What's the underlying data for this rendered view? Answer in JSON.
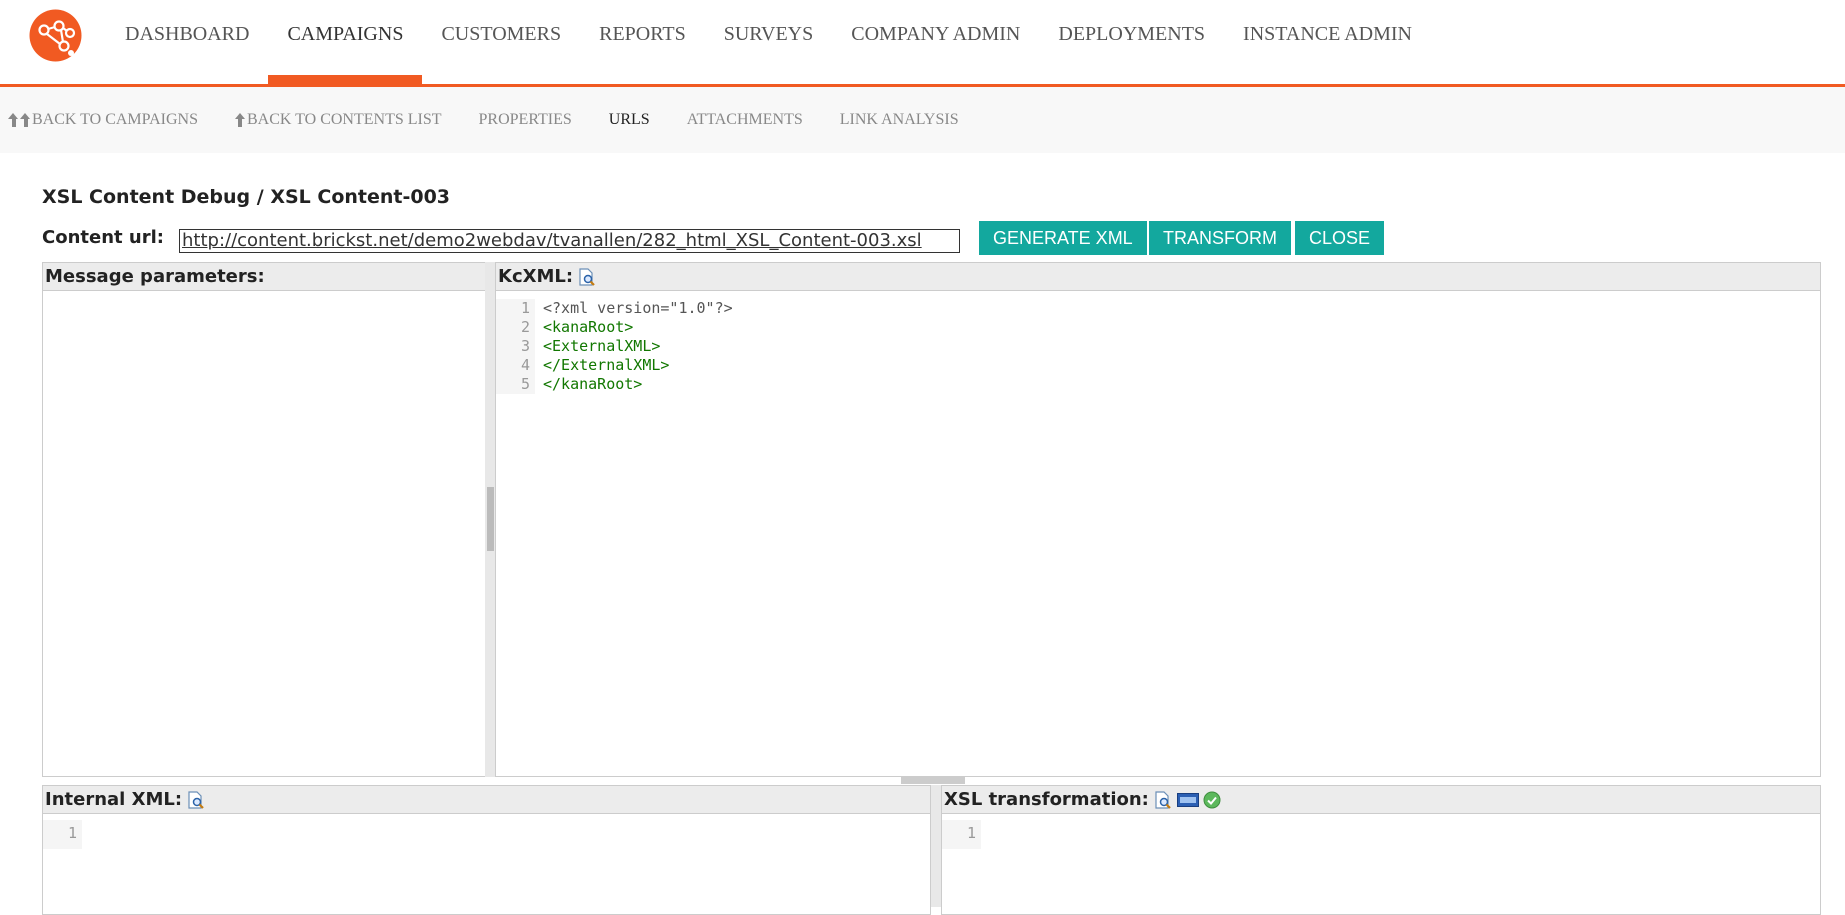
{
  "nav": {
    "items": [
      {
        "label": "DASHBOARD",
        "active": false
      },
      {
        "label": "CAMPAIGNS",
        "active": true
      },
      {
        "label": "CUSTOMERS",
        "active": false
      },
      {
        "label": "REPORTS",
        "active": false
      },
      {
        "label": "SURVEYS",
        "active": false
      },
      {
        "label": "COMPANY ADMIN",
        "active": false
      },
      {
        "label": "DEPLOYMENTS",
        "active": false
      },
      {
        "label": "INSTANCE ADMIN",
        "active": false
      }
    ]
  },
  "subnav": {
    "back_campaigns": "BACK TO CAMPAIGNS",
    "back_contents": "BACK TO CONTENTS LIST",
    "properties": "PROPERTIES",
    "urls": "URLS",
    "attachments": "ATTACHMENTS",
    "link_analysis": "LINK ANALYSIS"
  },
  "page": {
    "title": "XSL Content Debug / XSL Content-003",
    "url_label": "Content url:",
    "url_value": "http://content.brickst.net/demo2webdav/tvanallen/282_html_XSL_Content-003.xsl"
  },
  "buttons": {
    "generate": "GENERATE XML",
    "transform": "TRANSFORM",
    "close": "CLOSE"
  },
  "panels": {
    "message_params": "Message parameters:",
    "kcxml": "KcXML:",
    "internal_xml": "Internal XML:",
    "xsl_transformation": "XSL transformation:"
  },
  "kcxml_code": {
    "line_numbers": [
      "1",
      "2",
      "3",
      "4",
      "5"
    ],
    "lines": [
      "<?xml version=\"1.0\"?>",
      "<kanaRoot>",
      "<ExternalXML>",
      "</ExternalXML>",
      "</kanaRoot>"
    ]
  },
  "internal_code": {
    "line_numbers": [
      "1"
    ]
  },
  "xsl_code": {
    "line_numbers": [
      "1"
    ]
  },
  "colors": {
    "accent": "#f15a22",
    "button": "#13a89e",
    "xml_tag": "#117700"
  },
  "icons": [
    "logo-icon",
    "arrow-up-icon",
    "preview-icon",
    "html-icon",
    "check-icon"
  ]
}
